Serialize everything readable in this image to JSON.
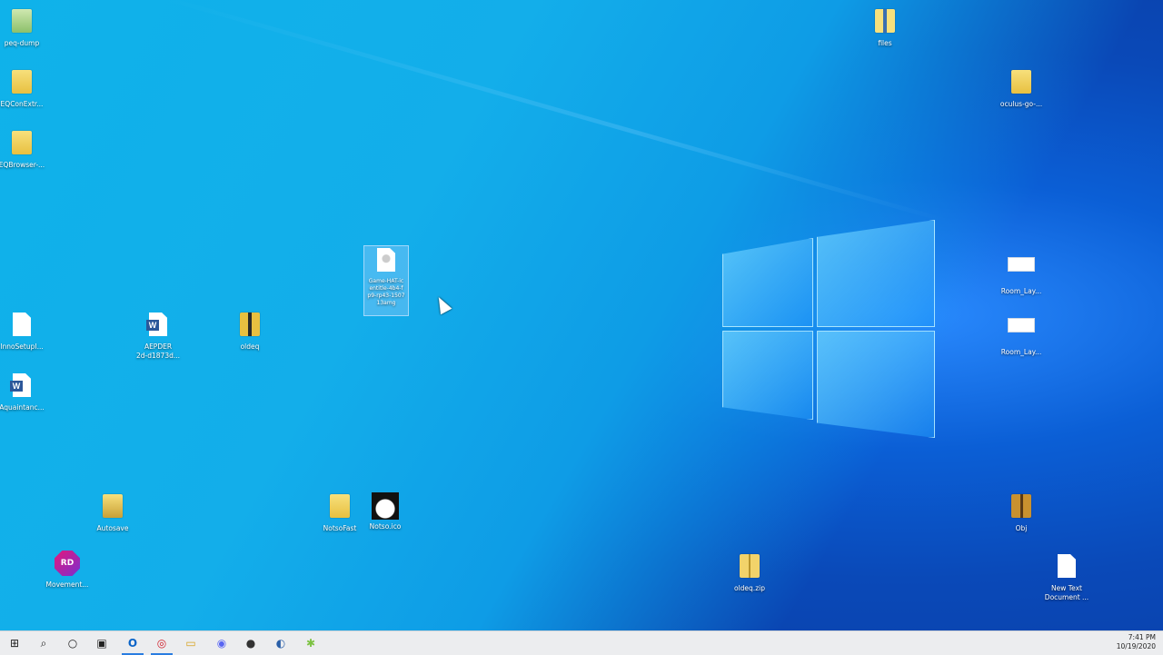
{
  "desktop": {
    "icons": [
      {
        "label": "peq-dump",
        "type": "app"
      },
      {
        "label": "EQConExtr...",
        "type": "folder"
      },
      {
        "label": "EQBrowser-...",
        "type": "folder"
      },
      {
        "label": "InnoSetupI...",
        "type": "doc"
      },
      {
        "label": "Aquaintanc...",
        "type": "word"
      },
      {
        "label": "AEPDER\n2d-d1873d...",
        "type": "word"
      },
      {
        "label": "oldeq",
        "type": "folder"
      },
      {
        "label": "Game-HAT-ic\nentitle-4b4-f\np9-rp43-1507\n13amg",
        "type": "doc"
      },
      {
        "label": "Autosave",
        "type": "folder"
      },
      {
        "label": "Movement...",
        "type": "app"
      },
      {
        "label": "NotsoFast",
        "type": "folder"
      },
      {
        "label": "Notso.ico",
        "type": "app"
      },
      {
        "label": "oldeq.zip",
        "type": "zip"
      },
      {
        "label": "files",
        "type": "folder"
      },
      {
        "label": "oculus-go-...",
        "type": "folder"
      },
      {
        "label": "Room_Lay...",
        "type": "image"
      },
      {
        "label": "Room_Lay...",
        "type": "image"
      },
      {
        "label": "Obj",
        "type": "folder"
      },
      {
        "label": "New Text\nDocument ...",
        "type": "doc"
      }
    ]
  },
  "taskbar": {
    "items": [
      {
        "icon": "windows-start-icon",
        "glyph": "⊞"
      },
      {
        "icon": "search-icon",
        "glyph": "⌕"
      },
      {
        "icon": "cortana-icon",
        "glyph": "○"
      },
      {
        "icon": "task-view-icon",
        "glyph": "▣"
      },
      {
        "icon": "outlook-icon",
        "glyph": "O"
      },
      {
        "icon": "opera-icon",
        "glyph": "◎"
      },
      {
        "icon": "file-explorer-icon",
        "glyph": "▭"
      },
      {
        "icon": "discord-icon",
        "glyph": "◉"
      },
      {
        "icon": "obs-icon",
        "glyph": "●"
      },
      {
        "icon": "browser-icon",
        "glyph": "◐"
      },
      {
        "icon": "android-studio-icon",
        "glyph": "✱"
      }
    ],
    "clock": {
      "time": "7:41 PM",
      "date": "10/19/2020"
    }
  }
}
